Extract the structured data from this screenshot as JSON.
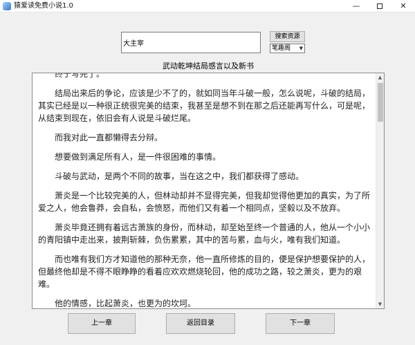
{
  "window": {
    "title": "猿爱读免费小说1.0",
    "minimize": "—",
    "close": "✕"
  },
  "search": {
    "value": "大主宰",
    "button_label": "搜索资源",
    "source_selected": "笔趣阁"
  },
  "chapter": {
    "title": "武动乾坤结局感言以及新书",
    "paragraphs": [
      "终于写完了。",
      "结局出来后的争论，应该是少不了的，就如同当年斗破一般，怎么说呢，斗破的结局，其实已经是以一种很正统很完美的结束，我甚至是想不到在那之后还能再写什么，可是呢，从结束到现在，依旧会有人说是斗破烂尾。",
      "而我对此一直都懒得去分辩。",
      "想要做到满足所有人，是一件很困难的事情。",
      "斗破与武动，是两个不同的故事，当在这之中，我们都获得了感动。",
      "萧炎是一个比较完美的人，但林动却并不显得完美，但我却觉得他更加的真实，为了所爱之人，他会鲁莽，会自私，会愤怒，而他们又有着一个相同点，坚毅以及不放弃。",
      "萧炎毕竟还拥有着远古萧族的身份，而林动，却至始至终一个普通的人，他从一个小小的青阳镇中走出来，披荆斩棘，负伤累累，其中的苦与累，血与火，唯有我们知道。",
      "而也唯有我们方才知道他的那种无奈，他一直所修炼的目的，便是保护想要保护的人，但最终他却是不得不眼睁睁的看着应欢欢燃烧轮回，他的成功之路，较之萧炎，更为的艰难。",
      "他的情感，比起萧炎，也更为的坎坷。"
    ]
  },
  "nav": {
    "prev_label": "上一章",
    "toc_label": "返回目录",
    "next_label": "下一章"
  },
  "icons": {
    "app": "book-icon",
    "scroll_up": "up-arrow-icon",
    "scroll_down": "down-arrow-icon",
    "select_caret": "chevron-down-icon"
  }
}
